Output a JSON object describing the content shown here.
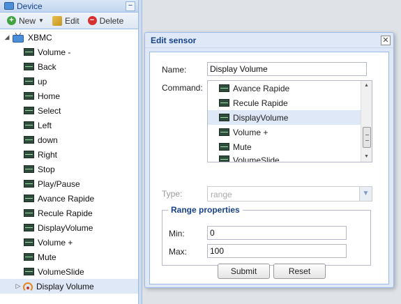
{
  "panel": {
    "title": "Device",
    "collapse_icon": "minus-icon",
    "toolbar": {
      "new_label": "New",
      "edit_label": "Edit",
      "delete_label": "Delete"
    },
    "tree": {
      "root_label": "XBMC",
      "root_icon": "tv-icon",
      "children": [
        "Volume -",
        "Back",
        "up",
        "Home",
        "Select",
        "Left",
        "down",
        "Right",
        "Stop",
        "Play/Pause",
        "Avance Rapide",
        "Recule Rapide",
        "DisplayVolume",
        "Volume +",
        "Mute",
        "VolumeSlide"
      ],
      "selected_label": "Display Volume"
    }
  },
  "dialog": {
    "title": "Edit sensor",
    "name_label": "Name:",
    "name_value": "Display Volume",
    "command_label": "Command:",
    "commands": [
      "Avance Rapide",
      "Recule Rapide",
      "DisplayVolume",
      "Volume +",
      "Mute",
      "VolumeSlide"
    ],
    "selected_command": "DisplayVolume",
    "type_label": "Type:",
    "type_value": "range",
    "range_legend": "Range properties",
    "min_label": "Min:",
    "min_value": "0",
    "max_label": "Max:",
    "max_value": "100",
    "submit_label": "Submit",
    "reset_label": "Reset"
  },
  "colors": {
    "header_text": "#15428b",
    "selection": "#dfe8f6",
    "border": "#99bbe8"
  }
}
